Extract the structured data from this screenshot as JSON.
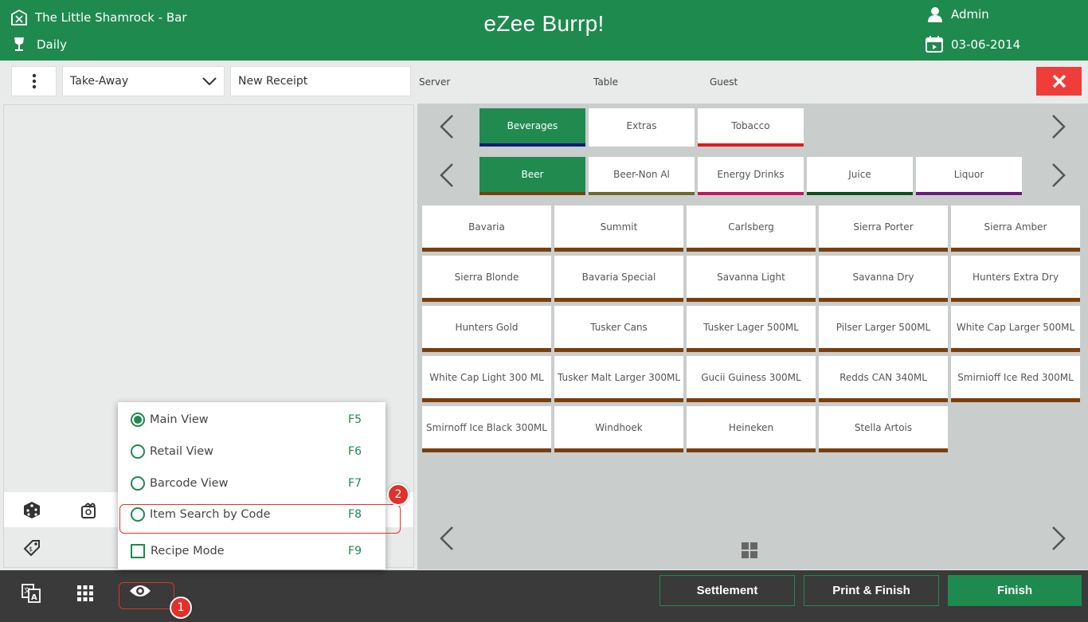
{
  "header": {
    "outlet": "The Little Shamrock - Bar",
    "day_mode": "Daily",
    "app_title": "eZee Burrp!",
    "user": "Admin",
    "date": "03-06-2014",
    "color": "#1e8a4e"
  },
  "toolbar": {
    "order_type": "Take-Away",
    "receipt": "New Receipt",
    "server_label": "Server",
    "table_label": "Table",
    "guest_label": "Guest",
    "close_color": "#ef3d3a"
  },
  "categories": [
    {
      "label": "Beverages",
      "color": "#0b1f7a",
      "active": true
    },
    {
      "label": "Extras",
      "color": "#ffffff",
      "active": false
    },
    {
      "label": "Tobacco",
      "color": "#e31b1b",
      "active": false
    }
  ],
  "subcategories": [
    {
      "label": "Beer",
      "color": "#7a3f0d",
      "active": true
    },
    {
      "label": "Beer-Non Al",
      "color": "#6b6a2e",
      "active": false
    },
    {
      "label": "Energy Drinks",
      "color": "#c2185b",
      "active": false
    },
    {
      "label": "Juice",
      "color": "#0b4f1c",
      "active": false
    },
    {
      "label": "Liquor",
      "color": "#6a1b7a",
      "active": false
    }
  ],
  "items": [
    "Bavaria",
    "Summit",
    "Carlsberg",
    "Sierra Porter",
    "Sierra Amber",
    "Sierra Blonde",
    "Bavaria Special",
    "Savanna Light",
    "Savanna Dry",
    "Hunters Extra Dry",
    "Hunters Gold",
    "Tusker Cans",
    "Tusker Lager 500ML",
    "Pilser Larger 500ML",
    "White Cap Larger 500ML",
    "White Cap Light 300 ML",
    "Tusker Malt Larger 300ML",
    "Gucii Guiness 300ML",
    "Redds CAN 340ML",
    "Smirnioff Ice Red  300ML",
    "Smirnoff Ice Black 300ML",
    "Windhoek",
    "Heineken",
    "Stella Artois"
  ],
  "view_menu": [
    {
      "label": "Main View",
      "key": "F5",
      "type": "radio",
      "selected": true
    },
    {
      "label": "Retail View",
      "key": "F6",
      "type": "radio",
      "selected": false
    },
    {
      "label": "Barcode View",
      "key": "F7",
      "type": "radio",
      "selected": false
    },
    {
      "label": "Item Search by Code",
      "key": "F8",
      "type": "radio",
      "selected": false
    },
    {
      "label": "Recipe Mode",
      "key": "F9",
      "type": "checkbox",
      "selected": false
    }
  ],
  "bottom": {
    "settlement": "Settlement",
    "print_finish": "Print & Finish",
    "finish": "Finish"
  },
  "annotations": {
    "badge1": "1",
    "badge2": "2"
  }
}
